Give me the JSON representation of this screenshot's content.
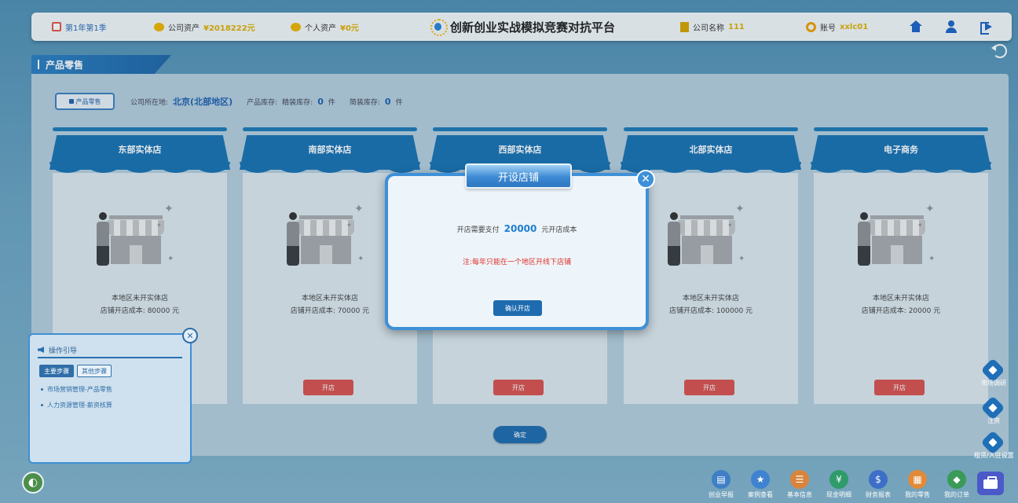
{
  "header": {
    "season": "第1年第1季",
    "company_assets_label": "公司资产",
    "company_assets_value": "¥2018222元",
    "personal_assets_label": "个人资产",
    "personal_assets_value": "¥0元",
    "app_title": "创新创业实战模拟竞赛对抗平台",
    "company_name_label": "公司名称",
    "company_name_value": "111",
    "account_label": "账号",
    "account_value": "xxlc01"
  },
  "section": {
    "title": "产品零售",
    "retail_button": "产品零售",
    "location_label": "公司所在地:",
    "location_value": "北京(北部地区)",
    "stock_label": "产品库存:",
    "fine_stock_label": "精装库存:",
    "fine_stock_value": "0",
    "simple_stock_label": "简装库存:",
    "simple_stock_value": "0",
    "unit": "件"
  },
  "stores": [
    {
      "name": "东部实体店",
      "status": "本地区未开实体店",
      "cost_text": "店铺开店成本: 80000 元",
      "button": "开店"
    },
    {
      "name": "南部实体店",
      "status": "本地区未开实体店",
      "cost_text": "店铺开店成本: 70000 元",
      "button": "开店"
    },
    {
      "name": "西部实体店",
      "status": "",
      "cost_text": "",
      "button": "开店"
    },
    {
      "name": "北部实体店",
      "status": "本地区未开实体店",
      "cost_text": "店铺开店成本: 100000 元",
      "button": "开店"
    },
    {
      "name": "电子商务",
      "status": "本地区未开实体店",
      "cost_text": "店铺开店成本: 20000 元",
      "button": "开店"
    }
  ],
  "confirm_button": "确定",
  "modal": {
    "title": "开设店铺",
    "text_before": "开店需要支付",
    "cost": "20000",
    "text_after": "元开店成本",
    "note": "注:每年只能在一个地区开线下店铺",
    "button": "确认开店"
  },
  "guide": {
    "title": "操作引导",
    "tab_main": "主要步骤",
    "tab_other": "其他步骤",
    "items": [
      "市场营销管理-产品零售",
      "人力资源管理-薪资核算"
    ]
  },
  "side_tools": [
    "市场调研",
    "注资",
    "租赁/入驻设置"
  ],
  "dock": [
    {
      "label": "创业早报",
      "color": "#3e7fc6"
    },
    {
      "label": "案例查看",
      "color": "#3f82cf"
    },
    {
      "label": "基本信息",
      "color": "#d9843c"
    },
    {
      "label": "现金明细",
      "color": "#2f9a6a"
    },
    {
      "label": "财务报表",
      "color": "#3d6fc8"
    },
    {
      "label": "我的零售",
      "color": "#e08a3a"
    },
    {
      "label": "我的订单",
      "color": "#3a9a58"
    }
  ]
}
